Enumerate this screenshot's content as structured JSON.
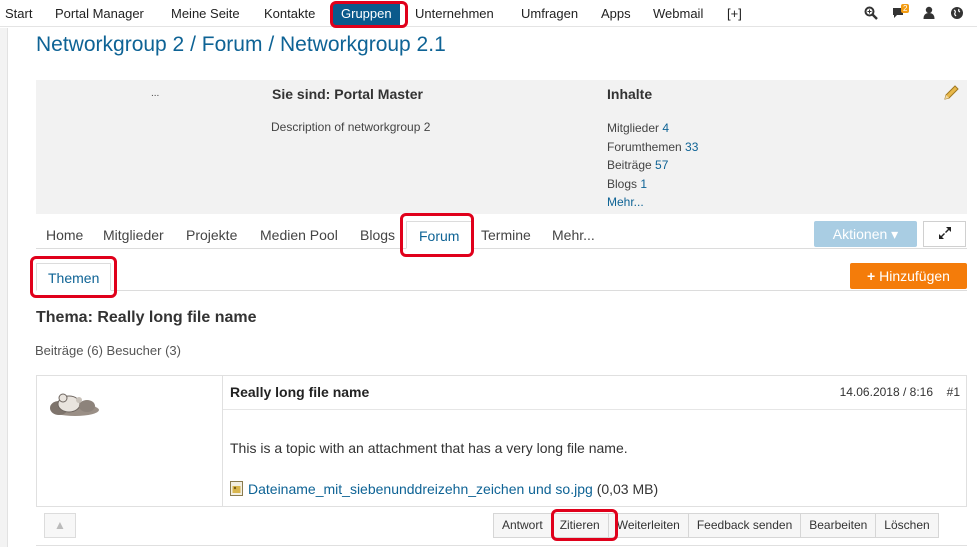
{
  "topnav": {
    "items": [
      "Start",
      "Portal Manager",
      "Meine Seite",
      "Kontakte",
      "Gruppen",
      "Unternehmen",
      "Umfragen",
      "Apps",
      "Webmail",
      "[+]"
    ],
    "active": "Gruppen",
    "notification_count": "2",
    "icons": [
      "search-icon",
      "chat-icon",
      "user-icon",
      "globe-icon"
    ]
  },
  "breadcrumb": {
    "part1": "Networkgroup 2",
    "sep1": "/",
    "part2": "Forum",
    "sep2": "/",
    "part3": "Networkgroup 2.1"
  },
  "info": {
    "dots": "...",
    "role": "Sie sind: Portal Master",
    "description": "Description of networkgroup 2",
    "inhalte_title": "Inhalte",
    "stats": [
      {
        "label": "Mitglieder",
        "value": "4"
      },
      {
        "label": "Forumthemen",
        "value": "33"
      },
      {
        "label": "Beiträge",
        "value": "57"
      },
      {
        "label": "Blogs",
        "value": "1"
      }
    ],
    "more": "Mehr..."
  },
  "tabs": {
    "items": [
      "Home",
      "Mitglieder",
      "Projekte",
      "Medien Pool",
      "Blogs",
      "Forum",
      "Termine",
      "Mehr..."
    ],
    "active": "Forum",
    "aktionen": "Aktionen",
    "expand_icon": "expand-icon"
  },
  "subtabs": {
    "active": "Themen",
    "add_label": "Hinzufügen"
  },
  "topic": {
    "title": "Thema: Really long file name",
    "counts": "Beiträge (6) Besucher (3)"
  },
  "post": {
    "title": "Really long file name",
    "date": "14.06.2018 / 8:16",
    "number": "#1",
    "body": "This is a topic with an attachment that has a very long file name.",
    "attachment_name": "Dateiname_mit_siebenunddreizehn_zeichen und so.jpg",
    "attachment_size": "(0,03 MB)"
  },
  "actions": {
    "up_icon": "chevron-up-icon",
    "buttons": [
      "Antwort",
      "Zitieren",
      "Weiterleiten",
      "Feedback senden",
      "Bearbeiten",
      "Löschen"
    ]
  },
  "colors": {
    "brand_blue": "#0e6395",
    "active_nav": "#0a5a8c",
    "add_button": "#f47c0a",
    "annotation_red": "#e0001b"
  }
}
